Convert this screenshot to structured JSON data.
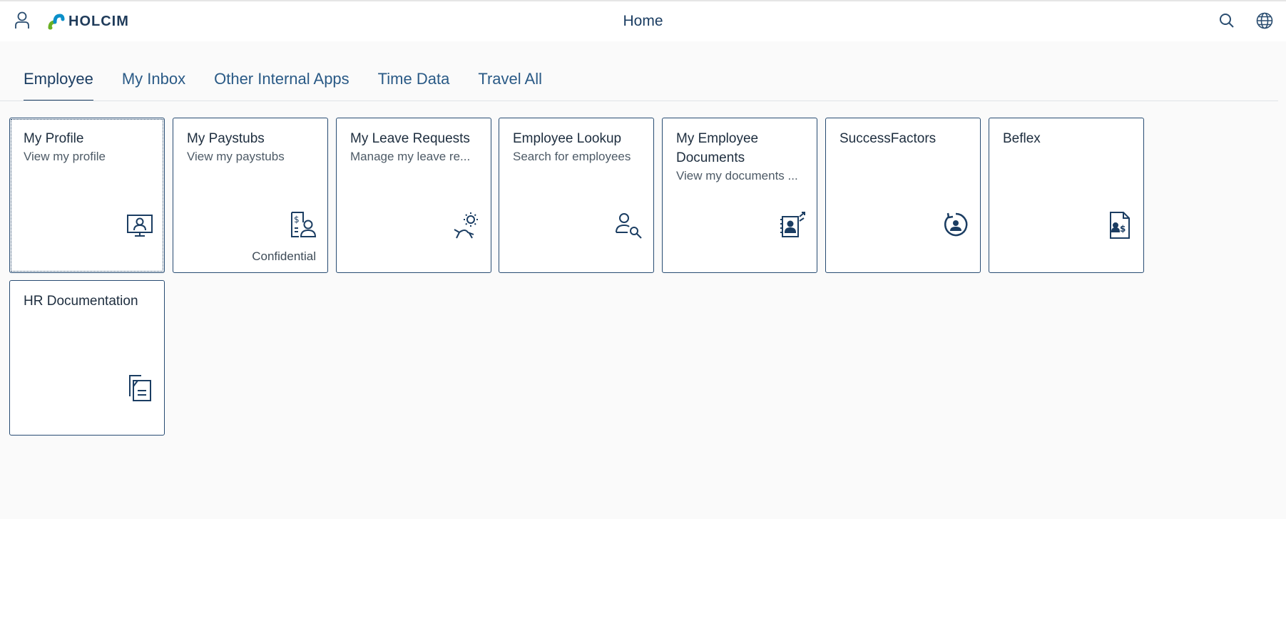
{
  "shell": {
    "title": "Home",
    "logo_text": "HOLCIM",
    "icons": {
      "user": "user-icon",
      "search": "search-icon",
      "language": "globe-icon"
    },
    "colors": {
      "accent": "#1b3d62",
      "tile_border": "#274b72",
      "logo_green": "#6ab023",
      "logo_blue": "#0a8fc9"
    }
  },
  "tabs": [
    {
      "label": "Employee",
      "active": true
    },
    {
      "label": "My Inbox"
    },
    {
      "label": "Other Internal Apps"
    },
    {
      "label": "Time Data"
    },
    {
      "label": "Travel All"
    }
  ],
  "tiles": [
    {
      "title": "My Profile",
      "subtitle": "View my profile",
      "icon": "profile-monitor-icon"
    },
    {
      "title": "My Paystubs",
      "subtitle": "View my paystubs",
      "icon": "paystub-person-icon",
      "footer": "Confidential"
    },
    {
      "title": "My Leave Requests",
      "subtitle": "Manage my leave re...",
      "icon": "sun-lounger-icon"
    },
    {
      "title": "Employee Lookup",
      "subtitle": "Search for employees",
      "icon": "person-search-icon"
    },
    {
      "title": "My Employee Documents",
      "subtitle": "View my documents ...",
      "icon": "employee-documents-icon"
    },
    {
      "title": "SuccessFactors",
      "subtitle": "",
      "icon": "person-circle-refresh-icon"
    },
    {
      "title": "Beflex",
      "subtitle": "",
      "icon": "person-dollar-document-icon"
    },
    {
      "title": "HR Documentation",
      "subtitle": "",
      "icon": "documents-icon"
    }
  ]
}
